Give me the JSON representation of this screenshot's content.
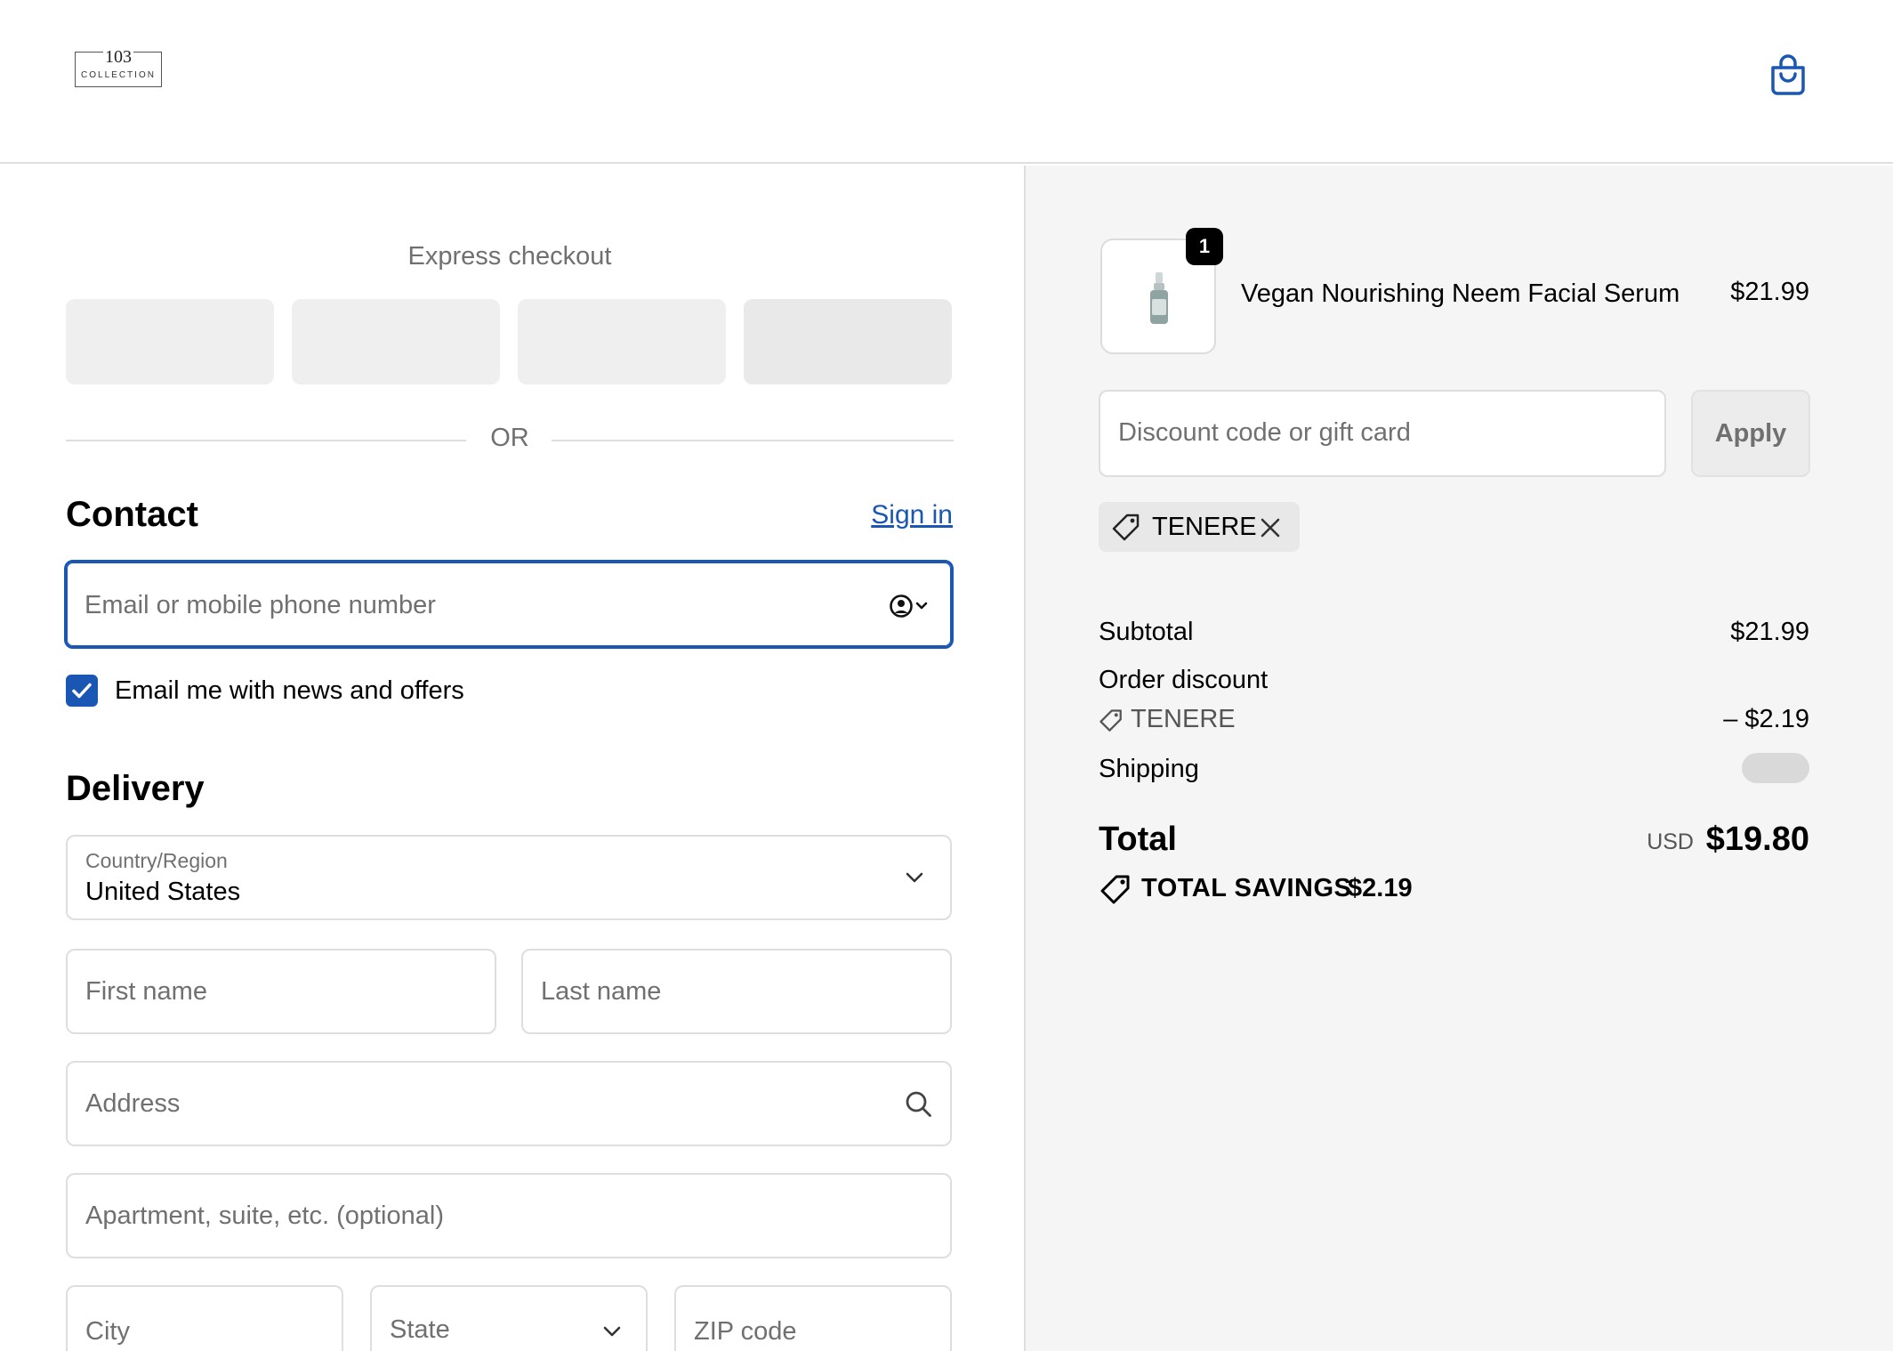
{
  "header": {
    "logo_number": "103",
    "logo_word": "COLLECTION"
  },
  "express": {
    "title": "Express checkout",
    "or_label": "OR"
  },
  "contact": {
    "heading": "Contact",
    "sign_in": "Sign in",
    "email_placeholder": "Email or mobile phone number",
    "newsletter_label": "Email me with news and offers",
    "newsletter_checked": true
  },
  "delivery": {
    "heading": "Delivery",
    "country_label": "Country/Region",
    "country_value": "United States",
    "first_name_placeholder": "First name",
    "last_name_placeholder": "Last name",
    "address_placeholder": "Address",
    "apartment_placeholder": "Apartment, suite, etc. (optional)",
    "city_placeholder": "City",
    "state_placeholder": "State",
    "zip_placeholder": "ZIP code"
  },
  "order": {
    "product": {
      "name": "Vegan Nourishing Neem Facial Serum",
      "price": "$21.99",
      "quantity": "1"
    },
    "discount_placeholder": "Discount code or gift card",
    "apply_label": "Apply",
    "applied_code": "TENERE",
    "subtotal_label": "Subtotal",
    "subtotal_value": "$21.99",
    "order_discount_label": "Order discount",
    "order_discount_code": "TENERE",
    "order_discount_value": "– $2.19",
    "shipping_label": "Shipping",
    "total_label": "Total",
    "total_currency": "USD",
    "total_value": "$19.80",
    "savings_label": "TOTAL SAVINGS",
    "savings_value": "$2.19"
  },
  "colors": {
    "accent": "#1a56b4",
    "muted_text": "#707070",
    "summary_bg": "#f5f5f5"
  }
}
